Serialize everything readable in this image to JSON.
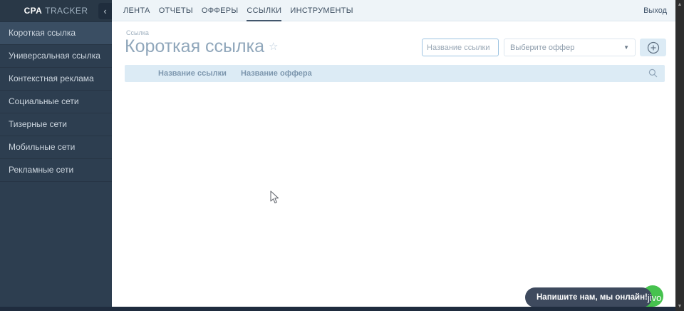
{
  "sidebar": {
    "logo": {
      "bold": "CPA",
      "rest": "TRACKER"
    },
    "collapse_icon": "‹",
    "items": [
      {
        "label": "Короткая ссылка",
        "active": true
      },
      {
        "label": "Универсальная ссылка",
        "active": false
      },
      {
        "label": "Контекстная реклама",
        "active": false
      },
      {
        "label": "Социальные сети",
        "active": false
      },
      {
        "label": "Тизерные сети",
        "active": false
      },
      {
        "label": "Мобильные сети",
        "active": false
      },
      {
        "label": "Рекламные сети",
        "active": false
      }
    ]
  },
  "topnav": {
    "tabs": [
      {
        "label": "ЛЕНТА",
        "active": false
      },
      {
        "label": "ОТЧЕТЫ",
        "active": false
      },
      {
        "label": "ОФФЕРЫ",
        "active": false
      },
      {
        "label": "ССЫЛКИ",
        "active": true
      },
      {
        "label": "ИНСТРУМЕНТЫ",
        "active": false
      }
    ],
    "logout": "Выход"
  },
  "page": {
    "breadcrumb": "Ссылка",
    "title": "Короткая ссылка",
    "star_icon": "☆",
    "link_name_placeholder": "Название ссылки",
    "offer_select_value": "Выберите оффер",
    "select_caret": "▼",
    "table": {
      "col_link_name": "Название ссылки",
      "col_offer_name": "Название оффера"
    }
  },
  "chat": {
    "message": "Напишите нам, мы онлайн!",
    "brand": "jivo"
  },
  "scrollbar": {
    "up": "▲",
    "down": "▼"
  },
  "colors": {
    "sidebar_bg": "#2d3e50",
    "sidebar_active_bg": "#3a4e63",
    "topnav_bg": "#eef4f8",
    "focused_input_border": "#9ec4e2",
    "table_header_bg": "#dcebf5",
    "title_color": "#90a7bb",
    "chat_bg": "#3e4a5e",
    "chat_green": "#46c24e",
    "bottom_strip": "#1f2c3e"
  }
}
